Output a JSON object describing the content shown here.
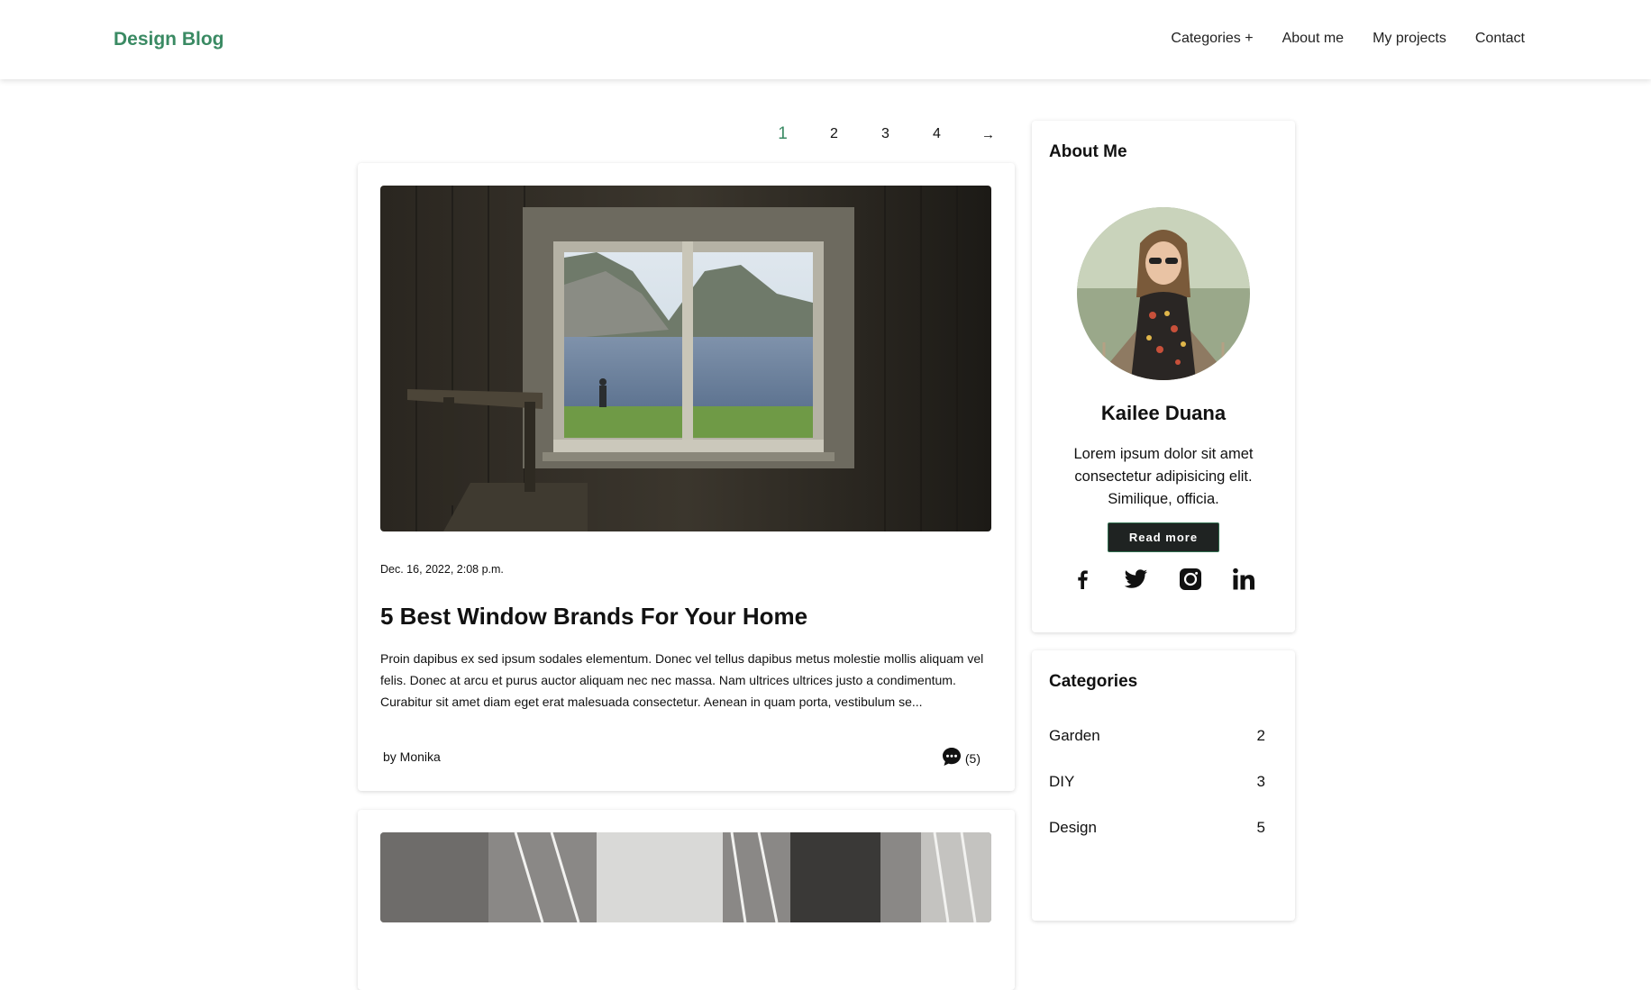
{
  "header": {
    "brand": "Design Blog",
    "nav": [
      "Categories +",
      "About me",
      "My projects",
      "Contact"
    ]
  },
  "pagination": {
    "pages": [
      "1",
      "2",
      "3",
      "4"
    ],
    "current": "1",
    "next": "→"
  },
  "post": {
    "date": "Dec. 16, 2022, 2:08 p.m.",
    "title": "5 Best Window Brands For Your Home",
    "excerpt": "Proin dapibus ex sed ipsum sodales elementum. Donec vel tellus dapibus metus molestie mollis aliquam vel felis. Donec at arcu et purus auctor aliquam nec nec massa. Nam ultrices ultrices justo a condimentum. Curabitur sit amet diam eget erat malesuada consectetur. Aenean in quam porta, vestibulum se...",
    "author": "by Monika",
    "comments": "(5)"
  },
  "about": {
    "title": "About Me",
    "name": "Kailee Duana",
    "text": "Lorem ipsum dolor sit amet consectetur adipisicing elit. Similique, officia.",
    "button": "Read more",
    "social_icons": [
      "facebook-icon",
      "twitter-icon",
      "instagram-icon",
      "linkedin-icon"
    ]
  },
  "categories": {
    "title": "Categories",
    "items": [
      {
        "name": "Garden",
        "count": "2"
      },
      {
        "name": "DIY",
        "count": "3"
      },
      {
        "name": "Design",
        "count": "5"
      }
    ]
  },
  "colors": {
    "accent": "#3a8a63",
    "button_bg": "#1f2322"
  }
}
